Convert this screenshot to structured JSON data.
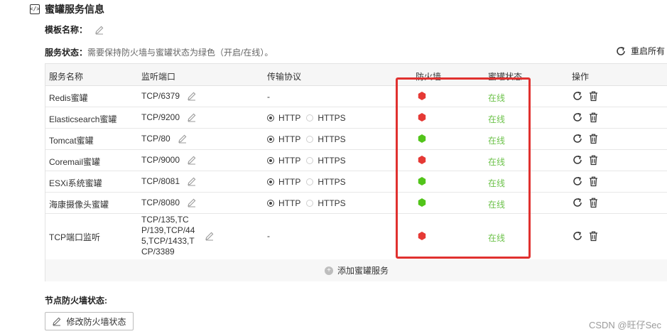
{
  "section": {
    "icon": "code-icon",
    "title": "蜜罐服务信息"
  },
  "template": {
    "label": "模板名称："
  },
  "service_status": {
    "label": "服务状态：",
    "hint": "需要保持防火墙与蜜罐状态为绿色（开启/在线）。"
  },
  "restart_all": {
    "label": "重启所有"
  },
  "table": {
    "headers": [
      "服务名称",
      "监听端口",
      "传输协议",
      "防火墙",
      "蜜罐状态",
      "操作"
    ],
    "rows": [
      {
        "name": "Redis蜜罐",
        "port": "TCP/6379",
        "protocol": "-",
        "firewall": "red",
        "status": "在线"
      },
      {
        "name": "Elasticsearch蜜罐",
        "port": "TCP/9200",
        "protocol": "radio",
        "http": "HTTP",
        "https": "HTTPS",
        "selected": "HTTP",
        "firewall": "red",
        "status": "在线"
      },
      {
        "name": "Tomcat蜜罐",
        "port": "TCP/80",
        "protocol": "radio",
        "http": "HTTP",
        "https": "HTTPS",
        "selected": "HTTP",
        "firewall": "green",
        "status": "在线"
      },
      {
        "name": "Coremail蜜罐",
        "port": "TCP/9000",
        "protocol": "radio",
        "http": "HTTP",
        "https": "HTTPS",
        "selected": "HTTP",
        "firewall": "red",
        "status": "在线"
      },
      {
        "name": "ESXi系统蜜罐",
        "port": "TCP/8081",
        "protocol": "radio",
        "http": "HTTP",
        "https": "HTTPS",
        "selected": "HTTP",
        "firewall": "green",
        "status": "在线"
      },
      {
        "name": "海康摄像头蜜罐",
        "port": "TCP/8080",
        "protocol": "radio",
        "http": "HTTP",
        "https": "HTTPS",
        "selected": "HTTP",
        "firewall": "green",
        "status": "在线"
      },
      {
        "name": "TCP端口监听",
        "port": "TCP/135,TCP/139,TCP/445,TCP/1433,TCP/3389",
        "port_lines": [
          "TCP/135,TC",
          "P/139,TCP/44",
          "5,TCP/1433,T",
          "CP/3389"
        ],
        "protocol": "-",
        "firewall": "red",
        "status": "在线"
      }
    ],
    "add_label": "添加蜜罐服务"
  },
  "firewall_section": {
    "title": "节点防火墙状态:",
    "button_label": "修改防火墙状态"
  },
  "watermark": "CSDN @旺仔Sec",
  "colors": {
    "firewall_red": "#e53935",
    "firewall_green": "#52c41a",
    "status_green": "#6cc24a",
    "highlight_red": "#e0312f"
  }
}
